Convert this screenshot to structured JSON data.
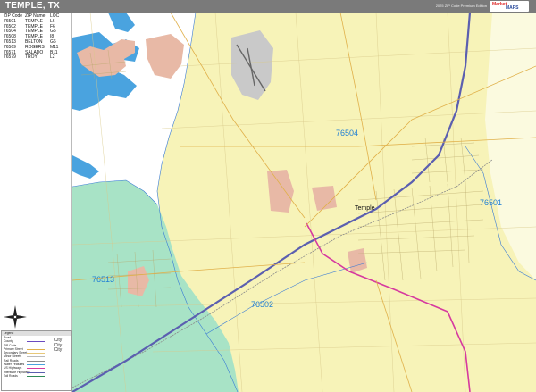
{
  "header": {
    "title": "TEMPLE, TX",
    "edition": "2025 ZIP Code Premium Edition",
    "logo_line1": "Market",
    "logo_line2": "MAPS"
  },
  "zip_table": {
    "headers": [
      "ZIP Code",
      "ZIP Name",
      "LOC"
    ],
    "rows": [
      [
        "76501",
        "TEMPLE",
        "L6"
      ],
      [
        "76502",
        "TEMPLE",
        "F6"
      ],
      [
        "76504",
        "TEMPLE",
        "G5"
      ],
      [
        "76508",
        "TEMPLE",
        "I8"
      ],
      [
        "76513",
        "BELTON",
        "G6"
      ],
      [
        "76569",
        "ROGERS",
        "M11"
      ],
      [
        "76571",
        "SALADO",
        "B11"
      ],
      [
        "76579",
        "TROY",
        "L2"
      ]
    ]
  },
  "map": {
    "zip_labels": [
      {
        "id": "76504",
        "text": "76504"
      },
      {
        "id": "76501",
        "text": "76501"
      },
      {
        "id": "76513",
        "text": "76513"
      },
      {
        "id": "76502",
        "text": "76502"
      }
    ],
    "city_labels": [
      {
        "id": "temple",
        "text": "Temple"
      }
    ],
    "colors": {
      "zip_yellow": "#f7f3b8",
      "zip_green": "#a8e3c6",
      "urban_pink": "#e8b9a6",
      "water": "#4aa3df",
      "highway": "#5b5fb0",
      "route_magenta": "#d63a9f",
      "rail": "#8a8a8a",
      "boundary_blue": "#3a7bd5"
    }
  },
  "legend": {
    "header": "Legend",
    "rows": [
      "Road",
      "County",
      "ZIP Code",
      "Primary Street",
      "Secondary Street",
      "Minor Streets",
      "Rail Roads",
      "Water Features",
      "US Highways",
      "Interstate Highways",
      "Toll Roads"
    ],
    "city_text": [
      "City",
      "City",
      "City"
    ]
  },
  "compass": {
    "icon": "compass-rose-icon"
  }
}
